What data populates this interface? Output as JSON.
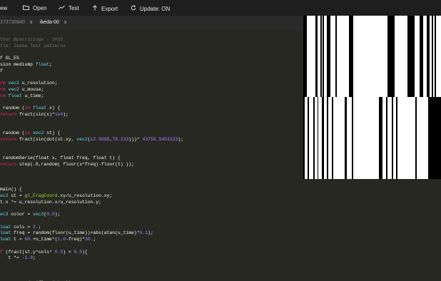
{
  "toolbar": {
    "items": [
      {
        "label": "ew",
        "icon": "new-icon"
      },
      {
        "label": "Open",
        "icon": "folder-icon"
      },
      {
        "label": "Test",
        "icon": "chart-icon"
      },
      {
        "label": "Export",
        "icon": "upload-icon"
      },
      {
        "label": "Update: ON",
        "icon": "refresh-icon"
      }
    ]
  },
  "tabs": [
    {
      "label": "373730840",
      "close": "x",
      "active": false
    },
    {
      "label": "ikeda-00",
      "close": "x",
      "active": true
    }
  ],
  "code_lines": [
    [
      [
        "thor @patriciogv - 2015",
        "#75715e"
      ]
    ],
    [
      [
        "tle: Ikeda Test patterns",
        "#75715e"
      ]
    ],
    [
      [
        "",
        "#f8f8f2"
      ]
    ],
    [
      [
        "f GL_ES",
        "#f8f8f2"
      ]
    ],
    [
      [
        "sion mediump ",
        "#f8f8f2"
      ],
      [
        "float",
        "#66d9ef"
      ],
      [
        ";",
        "#f8f8f2"
      ]
    ],
    [
      [
        "f",
        "#f8f8f2"
      ]
    ],
    [
      [
        "",
        "#f8f8f2"
      ]
    ],
    [
      [
        "rm ",
        "#f92672"
      ],
      [
        "vec2",
        "#66d9ef"
      ],
      [
        " u_resolution;",
        "#f8f8f2"
      ]
    ],
    [
      [
        "rm ",
        "#f92672"
      ],
      [
        "vec2",
        "#66d9ef"
      ],
      [
        " u_mouse;",
        "#f8f8f2"
      ]
    ],
    [
      [
        "rm ",
        "#f92672"
      ],
      [
        "float",
        "#66d9ef"
      ],
      [
        " u_time;",
        "#f8f8f2"
      ]
    ],
    [
      [
        "",
        "#f8f8f2"
      ]
    ],
    [
      [
        " random (",
        "#f8f8f2"
      ],
      [
        "in",
        "#f92672"
      ],
      [
        " ",
        "#f8f8f2"
      ],
      [
        "float",
        "#66d9ef"
      ],
      [
        " x) {",
        "#f8f8f2"
      ]
    ],
    [
      [
        "return",
        "#f92672"
      ],
      [
        " fract(sin(x)*",
        "#f8f8f2"
      ],
      [
        "1e4",
        "#ae81ff"
      ],
      [
        ");",
        "#f8f8f2"
      ]
    ],
    [
      [
        "",
        "#f8f8f2"
      ]
    ],
    [
      [
        "",
        "#f8f8f2"
      ]
    ],
    [
      [
        " random (",
        "#f8f8f2"
      ],
      [
        "in",
        "#f92672"
      ],
      [
        " ",
        "#f8f8f2"
      ],
      [
        "vec2",
        "#66d9ef"
      ],
      [
        " st) {",
        "#f8f8f2"
      ]
    ],
    [
      [
        "return",
        "#f92672"
      ],
      [
        " fract(sin(dot(st.xy, ",
        "#f8f8f2"
      ],
      [
        "vec2",
        "#66d9ef"
      ],
      [
        "(",
        "#f8f8f2"
      ],
      [
        "12.9898",
        "#ae81ff"
      ],
      [
        ",",
        "#f8f8f2"
      ],
      [
        "78.233",
        "#ae81ff"
      ],
      [
        ")))* ",
        "#f8f8f2"
      ],
      [
        "43758.5453123",
        "#ae81ff"
      ],
      [
        ");",
        "#f8f8f2"
      ]
    ],
    [
      [
        "",
        "#f8f8f2"
      ]
    ],
    [
      [
        "",
        "#f8f8f2"
      ]
    ],
    [
      [
        " randomSerie(float x, float freq, float t) {",
        "#f8f8f2"
      ]
    ],
    [
      [
        "return",
        "#f92672"
      ],
      [
        " step(.8,random( floor(x*freq)-floor(t) ));",
        "#f8f8f2"
      ]
    ],
    [
      [
        "",
        "#f8f8f2"
      ]
    ],
    [
      [
        "",
        "#f8f8f2"
      ]
    ],
    [
      [
        "",
        "#f8f8f2"
      ]
    ],
    [
      [
        "main() {",
        "#f8f8f2"
      ]
    ],
    [
      [
        "ec2",
        "#66d9ef"
      ],
      [
        " st = ",
        "#f8f8f2"
      ],
      [
        "gl_FragCoord",
        "#a6e22e"
      ],
      [
        ".xy/u_resolution.xy;",
        "#f8f8f2"
      ]
    ],
    [
      [
        "t.x *= u_resolution.x/u_resolution.y;",
        "#f8f8f2"
      ]
    ],
    [
      [
        "",
        "#f8f8f2"
      ]
    ],
    [
      [
        "ec3",
        "#66d9ef"
      ],
      [
        " color = ",
        "#f8f8f2"
      ],
      [
        "vec3",
        "#66d9ef"
      ],
      [
        "(",
        "#f8f8f2"
      ],
      [
        "0.0",
        "#ae81ff"
      ],
      [
        ");",
        "#f8f8f2"
      ]
    ],
    [
      [
        "",
        "#f8f8f2"
      ]
    ],
    [
      [
        "loat",
        "#66d9ef"
      ],
      [
        " cols = ",
        "#f8f8f2"
      ],
      [
        "2.",
        "#ae81ff"
      ],
      [
        ";",
        "#f8f8f2"
      ]
    ],
    [
      [
        "loat",
        "#66d9ef"
      ],
      [
        " freq = random(floor(u_time))+abs(atan(u_time)*",
        "#f8f8f2"
      ],
      [
        "0.1",
        "#ae81ff"
      ],
      [
        ");",
        "#f8f8f2"
      ]
    ],
    [
      [
        "loat",
        "#66d9ef"
      ],
      [
        " t = ",
        "#f8f8f2"
      ],
      [
        "60.",
        "#ae81ff"
      ],
      [
        "+u_time*(",
        "#f8f8f2"
      ],
      [
        "1.0",
        "#ae81ff"
      ],
      [
        "-freq)*",
        "#f8f8f2"
      ],
      [
        "30.",
        "#ae81ff"
      ],
      [
        ";",
        "#f8f8f2"
      ]
    ],
    [
      [
        "",
        "#f8f8f2"
      ]
    ],
    [
      [
        "f",
        "#f92672"
      ],
      [
        " (fract(st.y*cols* ",
        "#f8f8f2"
      ],
      [
        "0.5",
        "#ae81ff"
      ],
      [
        ") < ",
        "#f8f8f2"
      ],
      [
        "0.5",
        "#ae81ff"
      ],
      [
        "){",
        "#f8f8f2"
      ]
    ],
    [
      [
        "   t *= ",
        "#f8f8f2"
      ],
      [
        "-1.0",
        "#ae81ff"
      ],
      [
        ";",
        "#f8f8f2"
      ]
    ],
    [
      [
        "",
        "#f8f8f2"
      ]
    ],
    [
      [
        "",
        "#f8f8f2"
      ]
    ],
    [
      [
        "",
        "#f8f8f2"
      ]
    ],
    [
      [
        "req += random(floor(st.y));",
        "#f8f8f2"
      ]
    ]
  ]
}
